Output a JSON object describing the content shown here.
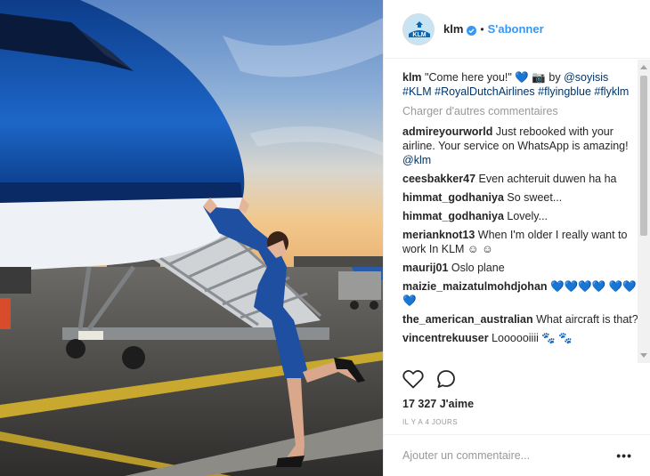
{
  "header": {
    "username": "klm",
    "dot": "•",
    "follow_label": "S'abonner",
    "verified_icon": "verified-badge-icon",
    "accent": "#3897f0"
  },
  "caption": {
    "username": "klm",
    "text": "\"Come here you!\" 💙 📷 by ",
    "mention": "@soyisis",
    "hashtags": "#KLM #RoyalDutchAirlines #flyingblue #flyklm"
  },
  "load_more": "Charger d'autres commentaires",
  "comments": [
    {
      "user": "admireyourworld",
      "text": "Just rebooked with your airline. Your service on WhatsApp is amazing! ",
      "mention": "@klm"
    },
    {
      "user": "ceesbakker47",
      "text": "Even achteruit duwen ha ha",
      "mention": ""
    },
    {
      "user": "himmat_godhaniya",
      "text": "So sweet...",
      "mention": ""
    },
    {
      "user": "himmat_godhaniya",
      "text": "Lovely...",
      "mention": ""
    },
    {
      "user": "merianknot13",
      "text": "When I'm older I really want to work In KLM ☺ ☺",
      "mention": ""
    },
    {
      "user": "maurij01",
      "text": "Oslo plane",
      "mention": ""
    },
    {
      "user": "maizie_maizatulmohdjohan",
      "text": "💙💙💙💙 💙💙💙",
      "mention": ""
    },
    {
      "user": "the_american_australian",
      "text": "What aircraft is that?",
      "mention": ""
    },
    {
      "user": "vincentrekuuser",
      "text": "Loooooiiii 🐾 🐾",
      "mention": ""
    }
  ],
  "actions": {
    "like_icon": "heart-icon",
    "comment_icon": "comment-icon"
  },
  "likes": "17 327 J'aime",
  "time": "IL Y A 4 JOURS",
  "add_comment": {
    "placeholder": "Ajouter un commentaire...",
    "more": "•••"
  },
  "colors": {
    "link": "#003569",
    "muted": "#999999",
    "klm_blue": "#0a4fa8"
  }
}
